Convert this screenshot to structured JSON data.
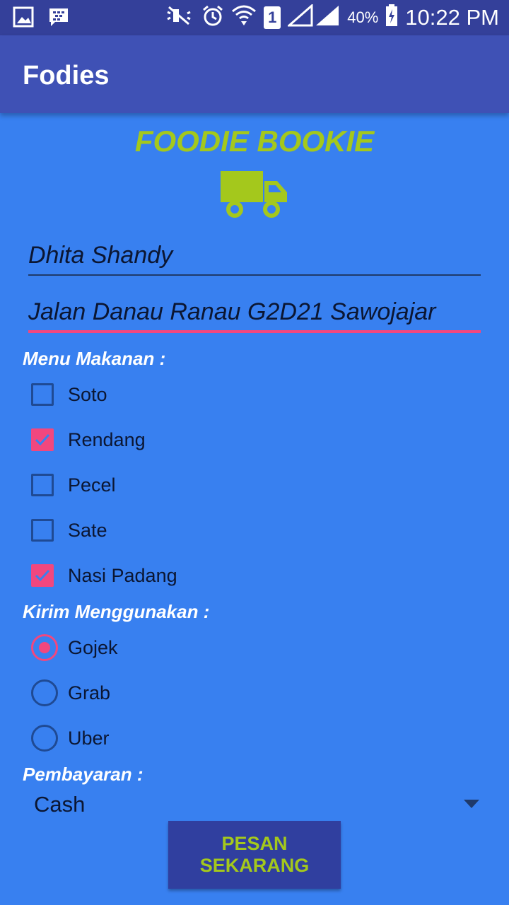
{
  "status_bar": {
    "time": "10:22 PM",
    "battery_percent": "40%",
    "sim_slot": "1",
    "icons": [
      "gallery-icon",
      "bbm-icon",
      "mute-icon",
      "alarm-icon",
      "wifi-icon",
      "signal-icon",
      "battery-charging-icon"
    ]
  },
  "app_bar": {
    "title": "Fodies"
  },
  "brand": {
    "title": "FOODIE BOOKIE",
    "icon": "truck-icon",
    "color": "#a4c81c"
  },
  "form": {
    "name_value": "Dhita Shandy",
    "address_value": "Jalan Danau Ranau G2D21 Sawojajar"
  },
  "menu_section": {
    "label": "Menu Makanan :",
    "items": [
      {
        "label": "Soto",
        "checked": false
      },
      {
        "label": "Rendang",
        "checked": true
      },
      {
        "label": "Pecel",
        "checked": false
      },
      {
        "label": "Sate",
        "checked": false
      },
      {
        "label": "Nasi Padang",
        "checked": true
      }
    ]
  },
  "delivery_section": {
    "label": "Kirim Menggunakan :",
    "options": [
      {
        "label": "Gojek",
        "selected": true
      },
      {
        "label": "Grab",
        "selected": false
      },
      {
        "label": "Uber",
        "selected": false
      }
    ]
  },
  "payment_section": {
    "label": "Pembayaran :",
    "selected": "Cash"
  },
  "submit_button": {
    "label": "PESAN SEKARANG"
  },
  "colors": {
    "background": "#3880f0",
    "app_bar": "#3f51b5",
    "accent": "#f2477e",
    "button": "#303f9f"
  }
}
